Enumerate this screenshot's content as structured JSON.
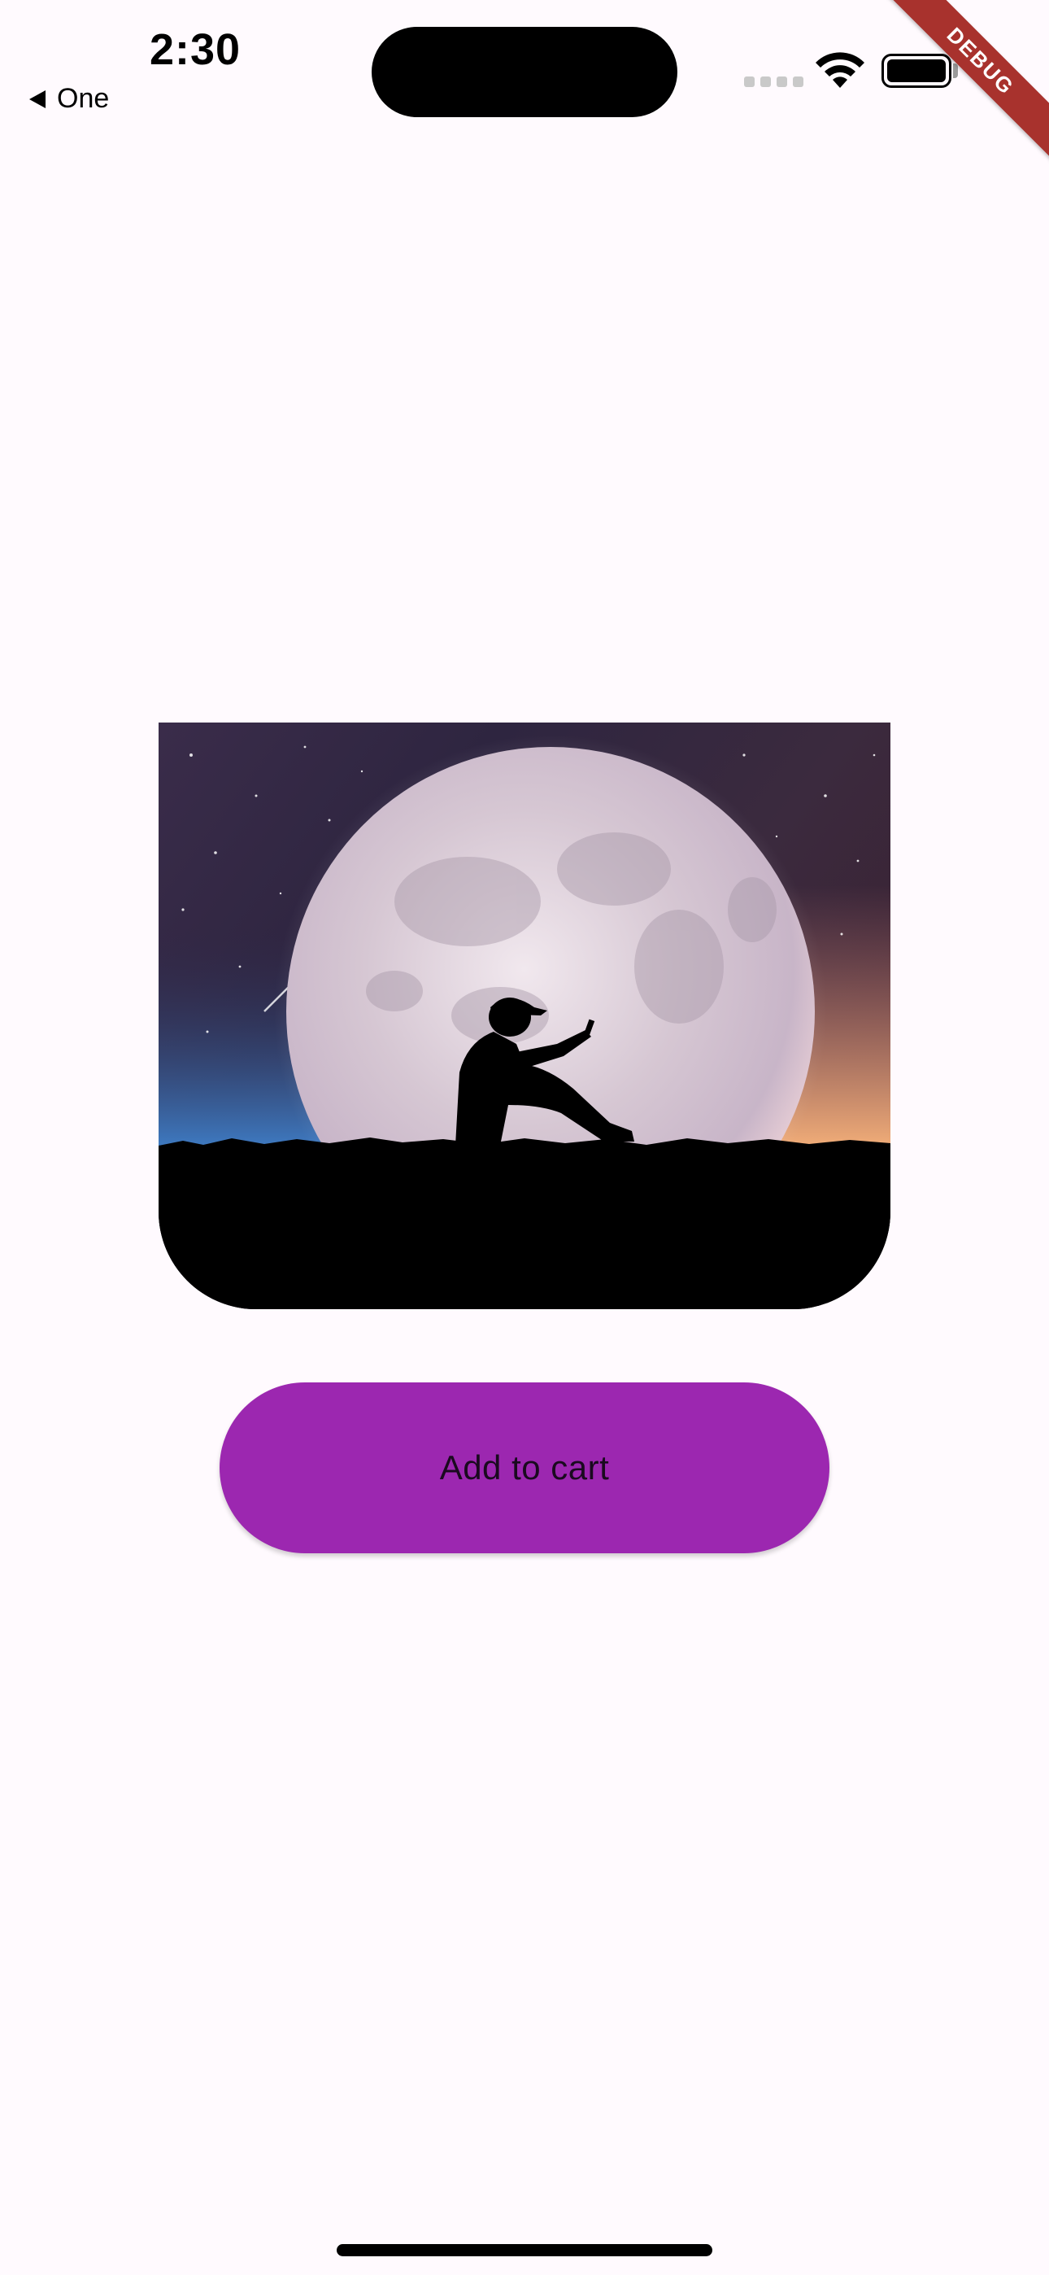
{
  "status_bar": {
    "time": "2:30",
    "icons": [
      "signal-icon",
      "wifi-icon",
      "battery-icon"
    ]
  },
  "nav": {
    "back_label": "One"
  },
  "debug_banner": {
    "label": "DEBUG",
    "color": "#A8322D"
  },
  "product": {
    "image_icon": "moon-silhouette-image"
  },
  "actions": {
    "add_to_cart_label": "Add to cart",
    "button_color": "#9C27B0"
  },
  "theme": {
    "background": "#FFFAFE"
  }
}
